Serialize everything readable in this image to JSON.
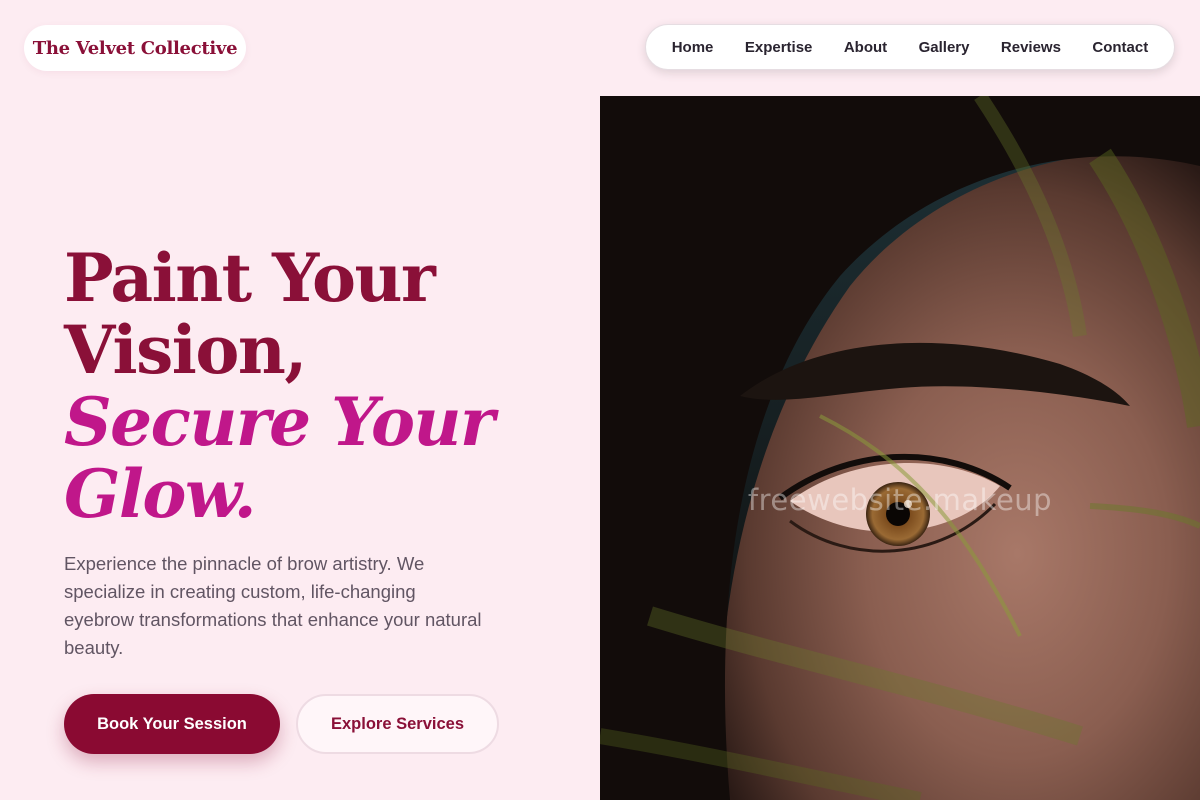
{
  "header": {
    "brand": "The Velvet Collective",
    "nav": [
      {
        "label": "Home"
      },
      {
        "label": "Expertise"
      },
      {
        "label": "About"
      },
      {
        "label": "Gallery"
      },
      {
        "label": "Reviews"
      },
      {
        "label": "Contact"
      }
    ]
  },
  "hero": {
    "headline_line1": "Paint Your",
    "headline_line2": "Vision,",
    "headline_line3": "Secure Your",
    "headline_line4": "Glow.",
    "description": "Experience the pinnacle of brow artistry. We specialize in creating custom, life-changing eyebrow transformations that enhance your natural beauty.",
    "primary_button": "Book Your Session",
    "secondary_button": "Explore Services",
    "image_watermark": "freewebsite.makeup"
  },
  "colors": {
    "background": "#fdecf2",
    "brand_dark": "#8a1038",
    "accent_magenta": "#c0178a",
    "button_primary": "#8a0a32"
  }
}
